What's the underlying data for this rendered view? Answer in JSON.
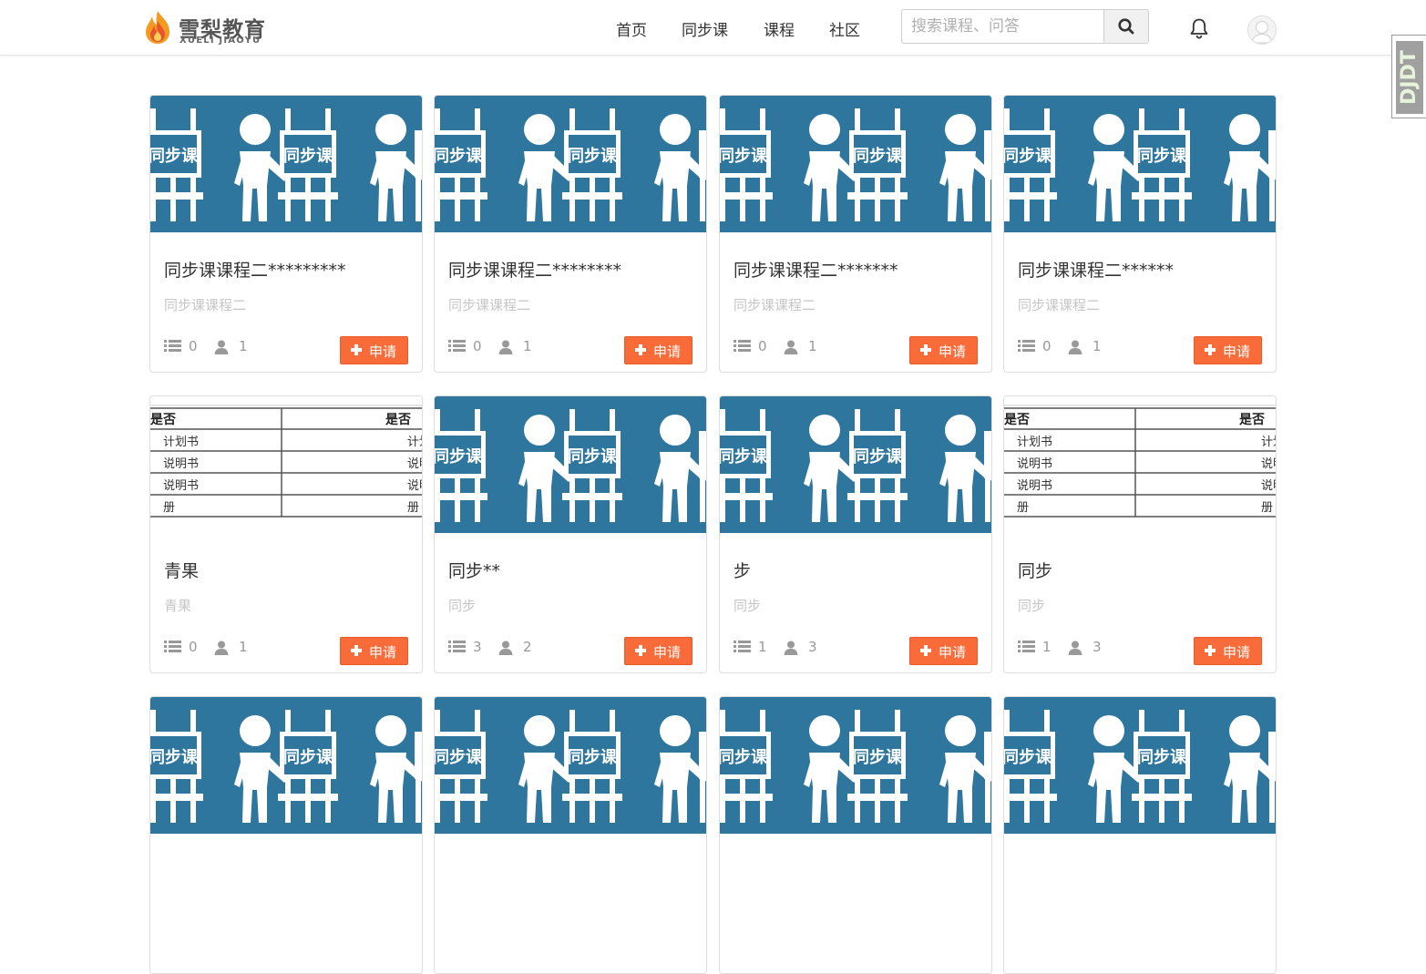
{
  "header": {
    "logo_cn": "雪梨教育",
    "logo_en": "XUELI JIAOYU",
    "nav": [
      "首页",
      "同步课",
      "课程",
      "社区"
    ],
    "search_placeholder": "搜索课程、问答",
    "side_tab_text": "DJDT"
  },
  "thumb_poster_text": "同步课",
  "thumb_doc_cells": {
    "header_left": "是否",
    "header_right": "是否",
    "rows": [
      "计划书",
      "说明书",
      "说明书",
      "册"
    ]
  },
  "colors": {
    "accent": "#f96c3a",
    "thumb_blue": "#2e769e",
    "brand_flame": "#f39a1f"
  },
  "cards": [
    {
      "title": "同步课课程二*********",
      "subtitle": "同步课课程二",
      "lessons": "0",
      "students": "1",
      "action": "申请",
      "thumb": "poster"
    },
    {
      "title": "同步课课程二********",
      "subtitle": "同步课课程二",
      "lessons": "0",
      "students": "1",
      "action": "申请",
      "thumb": "poster"
    },
    {
      "title": "同步课课程二*******",
      "subtitle": "同步课课程二",
      "lessons": "0",
      "students": "1",
      "action": "申请",
      "thumb": "poster"
    },
    {
      "title": "同步课课程二******",
      "subtitle": "同步课课程二",
      "lessons": "0",
      "students": "1",
      "action": "申请",
      "thumb": "poster"
    },
    {
      "title": "青果",
      "subtitle": "青果",
      "lessons": "0",
      "students": "1",
      "action": "申请",
      "thumb": "doc"
    },
    {
      "title": "同步**",
      "subtitle": "同步",
      "lessons": "3",
      "students": "2",
      "action": "申请",
      "thumb": "poster"
    },
    {
      "title": "步",
      "subtitle": "同步",
      "lessons": "1",
      "students": "3",
      "action": "申请",
      "thumb": "poster"
    },
    {
      "title": "同步",
      "subtitle": "同步",
      "lessons": "1",
      "students": "3",
      "action": "申请",
      "thumb": "doc"
    },
    {
      "title": "",
      "subtitle": "",
      "lessons": "",
      "students": "",
      "action": "",
      "thumb": "poster"
    },
    {
      "title": "",
      "subtitle": "",
      "lessons": "",
      "students": "",
      "action": "",
      "thumb": "poster"
    },
    {
      "title": "",
      "subtitle": "",
      "lessons": "",
      "students": "",
      "action": "",
      "thumb": "poster"
    },
    {
      "title": "",
      "subtitle": "",
      "lessons": "",
      "students": "",
      "action": "",
      "thumb": "poster"
    }
  ]
}
